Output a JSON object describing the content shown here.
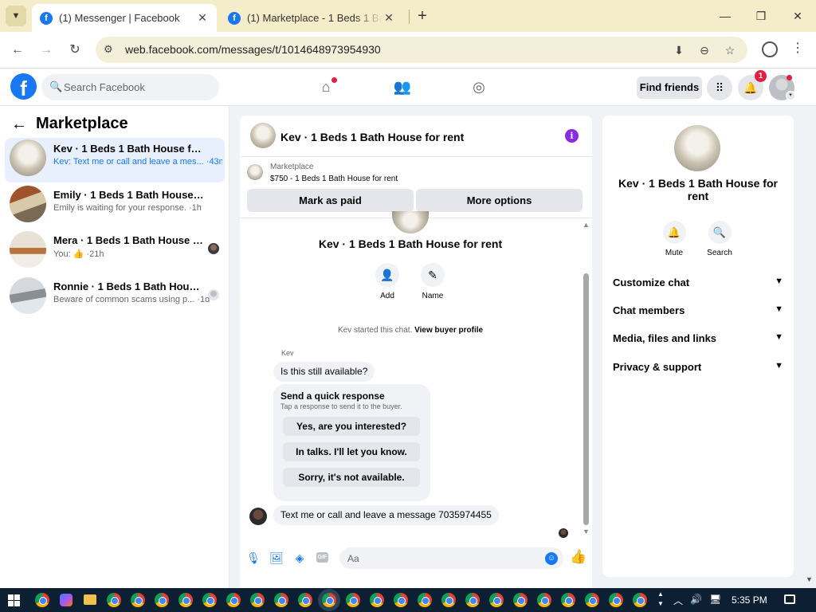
{
  "browser": {
    "tabs": [
      {
        "title": "(1) Messenger | Facebook",
        "active": true
      },
      {
        "title": "(1) Marketplace - 1 Beds 1 Bath",
        "active": false
      }
    ],
    "url": "web.facebook.com/messages/t/1014648973954930"
  },
  "fb_header": {
    "search_placeholder": "Search Facebook",
    "find_friends_label": "Find friends",
    "notification_count": "1"
  },
  "sidebar": {
    "title": "Marketplace",
    "conversations": [
      {
        "name": "Kev · 1 Beds 1 Bath House for rent",
        "snippet": "Kev: Text me or call and leave a mes... ·43m"
      },
      {
        "name": "Emily · 1 Beds 1 Bath House for rent",
        "snippet": "Emily is waiting for your response. ·1h"
      },
      {
        "name": "Mera · 1 Beds 1 Bath House for r...",
        "snippet": "You: 👍 ·21h"
      },
      {
        "name": "Ronnie · 1 Beds 1 Bath House for...",
        "snippet": "Beware of common scams using p... ·1d"
      }
    ]
  },
  "chat": {
    "header_name": "Kev · 1 Beds 1 Bath House for rent",
    "marketplace_label": "Marketplace",
    "listing": "$750 - 1 Beds 1 Bath House for rent",
    "mark_paid_label": "Mark as paid",
    "more_options_label": "More options",
    "body_name": "Kev · 1 Beds 1 Bath House for rent",
    "actions": {
      "add": "Add",
      "name": "Name"
    },
    "system_text": "Kev started this chat.",
    "view_profile": "View buyer profile",
    "sender": "Kev",
    "message_1": "Is this still available?",
    "quick_title": "Send a quick response",
    "quick_sub": "Tap a response to send it to the buyer.",
    "quick_options": [
      "Yes, are you interested?",
      "In talks. I'll let you know.",
      "Sorry, it's not available."
    ],
    "message_2": "Text me or call and leave a message 7035974455",
    "composer_placeholder": "Aa",
    "gif_label": "GIF"
  },
  "info_panel": {
    "name": "Kev · 1 Beds 1 Bath House for rent",
    "mute_label": "Mute",
    "search_label": "Search",
    "sections": [
      "Customize chat",
      "Chat members",
      "Media, files and links",
      "Privacy & support"
    ]
  },
  "taskbar": {
    "time": "5:35 PM"
  },
  "colors": {
    "brand": "#1877f2",
    "info_button": "#8a2be2",
    "badge": "#e41e3f"
  }
}
